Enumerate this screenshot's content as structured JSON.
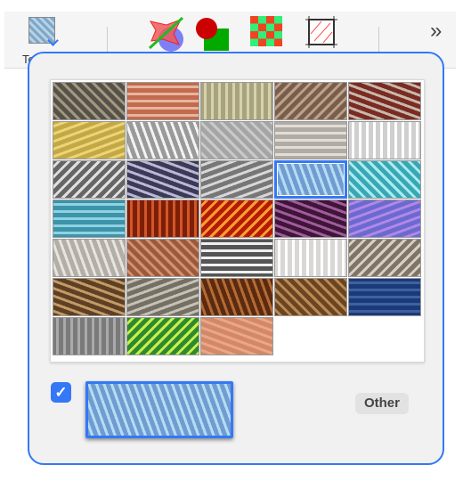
{
  "toolbar": {
    "partial_label": "Te",
    "more_icon": "»",
    "tools": [
      "texture-picker-icon",
      "no-fill-shape-icon",
      "sphere-box-icon",
      "checker-pattern-icon",
      "hatch-frame-icon"
    ]
  },
  "accent": "#3478f6",
  "textures": [
    [
      "#55524a",
      "#a3977f"
    ],
    [
      "#c46a4e",
      "#e4b79e"
    ],
    [
      "#a8a37c",
      "#d6d2ae"
    ],
    [
      "#7a5e4c",
      "#bca18a"
    ],
    [
      "#7a2b22",
      "#c7b7ad"
    ],
    [
      "#c4a844",
      "#ebd479"
    ],
    [
      "#9a9a9a",
      "#f3f3f3"
    ],
    [
      "#a5a5a5",
      "#c9c9c9"
    ],
    [
      "#b0aba3",
      "#e2ddd6"
    ],
    [
      "#cfcfcf",
      "#ffffff"
    ],
    [
      "#666",
      "#e0e0e0"
    ],
    [
      "#3c3b55",
      "#b9b6d8"
    ],
    [
      "#777",
      "#d7d7d7"
    ],
    [
      "#6f9dd2",
      "#b7dbf2"
    ],
    [
      "#3aa7b6",
      "#a9ecef"
    ],
    [
      "#3c93aa",
      "#8fd2e0"
    ],
    [
      "#7d1f07",
      "#d2562a"
    ],
    [
      "#b31b08",
      "#ff9d2e"
    ],
    [
      "#3f1538",
      "#a05b9c"
    ],
    [
      "#6a6ad0",
      "#b287e6"
    ],
    [
      "#b3aea6",
      "#e7e4df"
    ],
    [
      "#9b5a3e",
      "#d4916f"
    ],
    [
      "#555",
      "#f0f0f0"
    ],
    [
      "#d9d6d6",
      "#ffffff"
    ],
    [
      "#7f7468",
      "#d9cfc2"
    ],
    [
      "#5e4024",
      "#c39a66"
    ],
    [
      "#737066",
      "#c8c0b4"
    ],
    [
      "#5a2b10",
      "#b56a33"
    ],
    [
      "#6b4522",
      "#b98a55"
    ],
    [
      "#1d3a78",
      "#3d62a2"
    ],
    [
      "#7a7a7a",
      "#aaaaaa"
    ],
    [
      "#2f8a2f",
      "#c8ef4b"
    ],
    [
      "#d48867",
      "#e8a78a"
    ]
  ],
  "selected_index": 13,
  "use_texture_checked": true,
  "checkbox_glyph": "✓",
  "other_label": "Other"
}
